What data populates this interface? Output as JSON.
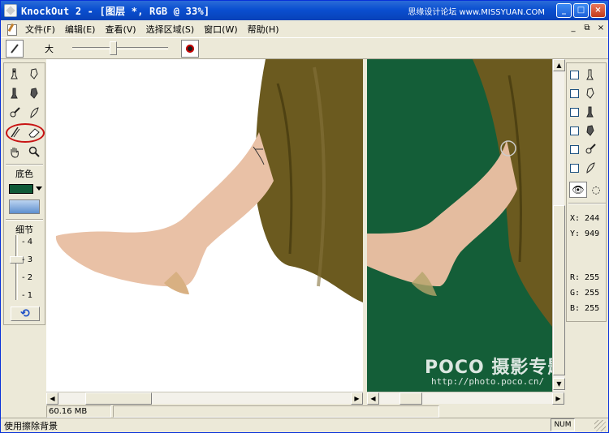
{
  "window": {
    "title": "KnockOut 2 - [图层 *, RGB @ 33%]",
    "top_watermark": "思缘设计论坛 www.MISSYUAN.COM",
    "buttons": {
      "minimize": "_",
      "maximize": "□",
      "close": "×"
    }
  },
  "menubar": {
    "items": [
      "文件(F)",
      "编辑(E)",
      "查看(V)",
      "选择区域(S)",
      "窗口(W)",
      "帮助(H)"
    ],
    "mdi_buttons": {
      "minimize": "_",
      "restore": "⧉",
      "close": "×"
    }
  },
  "options": {
    "size_label": "大",
    "slider_value": 0.4,
    "color_button": "brush-color-icon"
  },
  "toolbox": {
    "bg_color_label": "底色",
    "bg_color": "#0f5a37",
    "detail_label": "细节",
    "detail_ticks": [
      "4",
      "3",
      "2",
      "1"
    ],
    "detail_value": "3",
    "highlighted_tool": "eraser",
    "accent_ring": "#c81414"
  },
  "canvas": {
    "right_background": "#145e38",
    "watermark_main": "POCO 摄影专题",
    "watermark_url": "http://photo.poco.cn/"
  },
  "info_panel": {
    "x": "X: 244",
    "y": "Y: 949",
    "r": "R: 255",
    "g": "G: 255",
    "b": "B: 255"
  },
  "status": {
    "memory": "60.16 MB",
    "hint": "使用擦除背景",
    "num": "NUM"
  }
}
